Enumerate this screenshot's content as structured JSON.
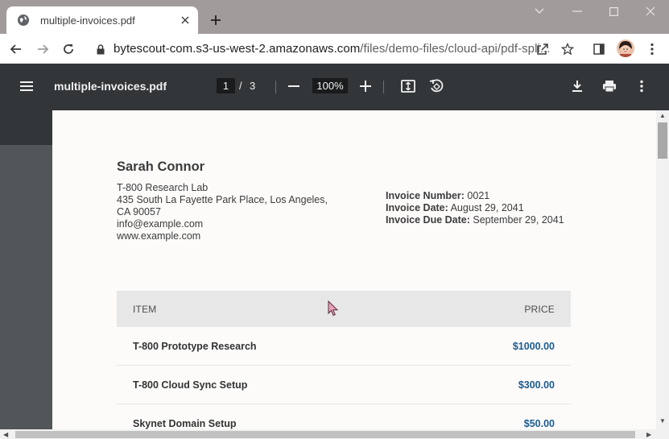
{
  "browser": {
    "tab_title": "multiple-invoices.pdf",
    "url_host": "bytescout-com.s3-us-west-2.amazonaws.com",
    "url_path": "/files/demo-files/cloud-api/pdf-spli..."
  },
  "pdf_toolbar": {
    "file_name": "multiple-invoices.pdf",
    "current_page": "1",
    "page_separator": "/",
    "total_pages": "3",
    "zoom": "100%"
  },
  "invoice": {
    "sender_name": "Sarah Connor",
    "sender_lines": [
      "T-800 Research Lab",
      "435 South La Fayette Park Place, Los Angeles,",
      "CA 90057",
      "info@example.com",
      "www.example.com"
    ],
    "meta": [
      {
        "label": "Invoice Number:",
        "value": " 0021"
      },
      {
        "label": "Invoice Date:",
        "value": " August 29, 2041"
      },
      {
        "label": "Invoice Due Date:",
        "value": " September 29, 2041"
      }
    ],
    "table": {
      "headers": {
        "item": "ITEM",
        "price": "PRICE"
      },
      "rows": [
        {
          "item": "T-800 Prototype Research",
          "price": "$1000.00"
        },
        {
          "item": "T-800 Cloud Sync Setup",
          "price": "$300.00"
        },
        {
          "item": "Skynet Domain Setup",
          "price": "$50.00"
        }
      ]
    }
  },
  "colors": {
    "tabstrip": "#a29b9b",
    "pdf_toolbar": "#323639",
    "price_blue": "#1d5b8f"
  }
}
